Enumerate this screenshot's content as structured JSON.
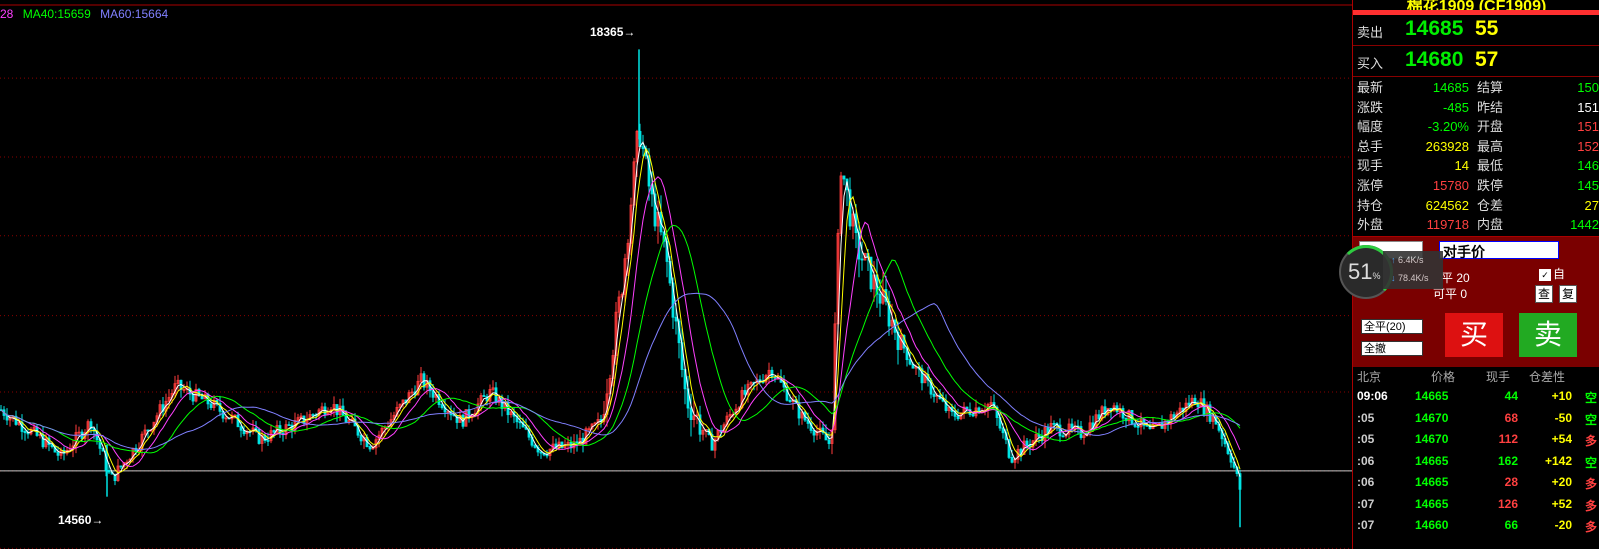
{
  "ma_legend": [
    {
      "text": "28",
      "color": "#ff40ff"
    },
    {
      "text": "MA40:15659",
      "color": "#00ff00"
    },
    {
      "text": "MA60:15664",
      "color": "#8080ff"
    }
  ],
  "high_label": "18365",
  "low_label": "14560",
  "chart_data": {
    "type": "candlestick",
    "high": 18365,
    "low": 14560,
    "ylim": [
      14200,
      18700
    ],
    "reference_price": 14780,
    "gridlines": [
      18120,
      17450,
      16780,
      16100,
      15450,
      14780,
      14120
    ],
    "series": [
      {
        "name": "MA40",
        "value": 15659,
        "color": "#00ff00"
      },
      {
        "name": "MA60",
        "value": 15664,
        "color": "#8080ff"
      }
    ]
  },
  "panel": {
    "title": "棉花1909 (CF1909)",
    "sell": {
      "label": "卖出",
      "price": "14685",
      "volume": "55"
    },
    "buy": {
      "label": "买入",
      "price": "14680",
      "volume": "57"
    },
    "stats_left": [
      {
        "k": "最新",
        "v": "14685",
        "color": "#00ff00"
      },
      {
        "k": "涨跌",
        "v": "-485",
        "color": "#00ff00"
      },
      {
        "k": "幅度",
        "v": "-3.20%",
        "color": "#00ff00"
      },
      {
        "k": "总手",
        "v": "263928",
        "color": "#ffff00"
      },
      {
        "k": "现手",
        "v": "14",
        "color": "#ffff00"
      },
      {
        "k": "涨停",
        "v": "15780",
        "color": "#ff4040"
      },
      {
        "k": "持仓",
        "v": "624562",
        "color": "#ffff00"
      },
      {
        "k": "外盘",
        "v": "119718",
        "color": "#ff4040"
      }
    ],
    "stats_right": [
      {
        "k": "结算",
        "v": "150",
        "color": "#00ff00"
      },
      {
        "k": "昨结",
        "v": "151",
        "color": "#ffffff"
      },
      {
        "k": "开盘",
        "v": "151",
        "color": "#ff4040"
      },
      {
        "k": "最高",
        "v": "152",
        "color": "#ff4040"
      },
      {
        "k": "最低",
        "v": "146",
        "color": "#00ff00"
      },
      {
        "k": "跌停",
        "v": "145",
        "color": "#00ff00"
      },
      {
        "k": "仓差",
        "v": "27",
        "color": "#ffff00"
      },
      {
        "k": "内盘",
        "v": "1442",
        "color": "#00ff00"
      }
    ],
    "order": {
      "price_type": "对手价",
      "auto_label": "自",
      "pos_label_1": "平 20",
      "pos_label_2": "可平 0",
      "btn_close_all": "全平(20)",
      "btn_cancel_all": "全撤",
      "buy_btn": "买",
      "sell_btn": "卖",
      "btn_check": "查",
      "btn_other": "复"
    },
    "speed": {
      "percent": "51",
      "pct_sign": "%",
      "up": "6.4K/s",
      "down": "78.4K/s"
    },
    "ticks_header": {
      "time": "北京",
      "price": "价格",
      "vol": "现手",
      "oi": "仓差",
      "nature": "性"
    },
    "ticks": [
      {
        "time": "09:06",
        "price": "14665",
        "vol": "44",
        "oi": "+10",
        "nature": "空",
        "vol_color": "#00ff00",
        "n_color": "#00ff00"
      },
      {
        "time": ":05",
        "price": "14670",
        "vol": "68",
        "oi": "-50",
        "nature": "空",
        "vol_color": "#ff4040",
        "n_color": "#00ff00"
      },
      {
        "time": ":05",
        "price": "14670",
        "vol": "112",
        "oi": "+54",
        "nature": "多",
        "vol_color": "#ff4040",
        "n_color": "#ff4040"
      },
      {
        "time": ":06",
        "price": "14665",
        "vol": "162",
        "oi": "+142",
        "nature": "空",
        "vol_color": "#00ff00",
        "n_color": "#00ff00"
      },
      {
        "time": ":06",
        "price": "14665",
        "vol": "28",
        "oi": "+20",
        "nature": "多",
        "vol_color": "#ff4040",
        "n_color": "#ff4040"
      },
      {
        "time": ":07",
        "price": "14665",
        "vol": "126",
        "oi": "+52",
        "nature": "多",
        "vol_color": "#ff4040",
        "n_color": "#ff4040"
      },
      {
        "time": ":07",
        "price": "14660",
        "vol": "66",
        "oi": "-20",
        "nature": "多",
        "vol_color": "#00ff00",
        "n_color": "#ff4040"
      }
    ]
  }
}
